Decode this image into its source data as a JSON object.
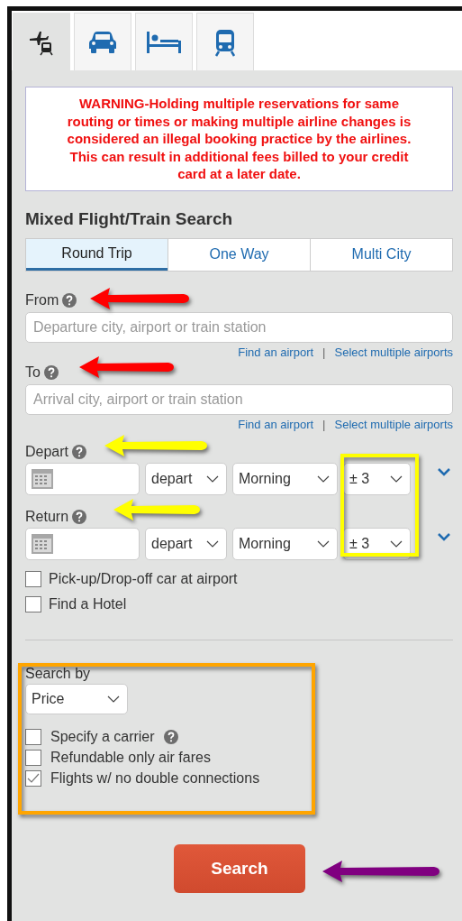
{
  "tabs": [
    {
      "kind": "flight-train",
      "selected": true
    },
    {
      "kind": "car",
      "selected": false
    },
    {
      "kind": "hotel",
      "selected": false
    },
    {
      "kind": "train",
      "selected": false
    }
  ],
  "warning": "WARNING-Holding multiple reservations for same routing or times or making multiple airline changes is considered an illegal booking practice by the airlines. This can result in additional fees billed to your credit card at a later date.",
  "title": "Mixed Flight/Train Search",
  "trip_types": [
    {
      "label": "Round Trip",
      "selected": true
    },
    {
      "label": "One Way",
      "selected": false
    },
    {
      "label": "Multi City",
      "selected": false
    }
  ],
  "locations": [
    {
      "label": "From",
      "help": true,
      "placeholder": "Departure city, airport or train station",
      "links": [
        "Find an airport",
        "Select multiple airports"
      ],
      "separator": "|"
    },
    {
      "label": "To",
      "help": true,
      "placeholder": "Arrival city, airport or train station",
      "links": [
        "Find an airport",
        "Select multiple airports"
      ],
      "separator": "|"
    }
  ],
  "dates": [
    {
      "label": "Depart",
      "help": true,
      "mode": "depart",
      "time": "Morning",
      "flex": "± 3"
    },
    {
      "label": "Return",
      "help": true,
      "mode": "depart",
      "time": "Morning",
      "flex": "± 3"
    }
  ],
  "extras": [
    {
      "label": "Pick-up/Drop-off car at airport",
      "checked": false
    },
    {
      "label": "Find a Hotel",
      "checked": false
    }
  ],
  "search_by": {
    "label": "Search by",
    "value": "Price"
  },
  "options": [
    {
      "label": "Specify a carrier",
      "help": true,
      "checked": false
    },
    {
      "label": "Refundable only air fares",
      "help": false,
      "checked": false
    },
    {
      "label": "Flights w/ no double connections",
      "help": false,
      "checked": true
    }
  ],
  "search_button": "Search",
  "annotations": [
    {
      "kind": "arrow",
      "color": "#ff0000"
    },
    {
      "kind": "arrow",
      "color": "#ff0000"
    },
    {
      "kind": "arrow",
      "color": "#ffff00"
    },
    {
      "kind": "arrow",
      "color": "#ffff00"
    },
    {
      "kind": "frame",
      "color": "#ffff00"
    },
    {
      "kind": "frame",
      "color": "#ffa500"
    },
    {
      "kind": "arrow",
      "color": "#800080"
    }
  ]
}
